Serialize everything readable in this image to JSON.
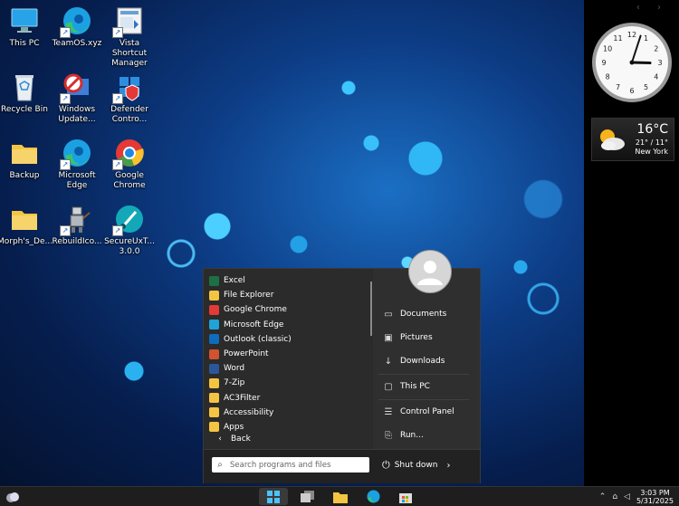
{
  "desktop": {
    "icons": [
      {
        "label": "This PC"
      },
      {
        "label": "TeamOS.xyz"
      },
      {
        "label": "Vista Shortcut Manager"
      },
      {
        "label": "Recycle Bin"
      },
      {
        "label": "Windows Update..."
      },
      {
        "label": "Defender Contro..."
      },
      {
        "label": "Backup"
      },
      {
        "label": "Microsoft Edge"
      },
      {
        "label": "Google Chrome"
      },
      {
        "label": "Morph's_De..."
      },
      {
        "label": "RebuildIco..."
      },
      {
        "label": "SecureUxT... 3.0.0"
      }
    ]
  },
  "gadgets": {
    "nav": "‹ ›",
    "clock": {
      "hour": 3,
      "minute": 3
    },
    "weather": {
      "temp": "16°C",
      "range": "21° / 11°",
      "city": "New York"
    }
  },
  "start_menu": {
    "programs": [
      {
        "label": "Excel",
        "icon": "excel-icon",
        "color": "#1d7044"
      },
      {
        "label": "File Explorer",
        "icon": "folder-icon",
        "color": "#f4c542"
      },
      {
        "label": "Google Chrome",
        "icon": "chrome-icon",
        "color": "#e53935"
      },
      {
        "label": "Microsoft Edge",
        "icon": "edge-icon",
        "color": "#1fa3d8"
      },
      {
        "label": "Outlook (classic)",
        "icon": "outlook-icon",
        "color": "#0f6cbd"
      },
      {
        "label": "PowerPoint",
        "icon": "powerpoint-icon",
        "color": "#d35230"
      },
      {
        "label": "Word",
        "icon": "word-icon",
        "color": "#2b579a"
      },
      {
        "label": "7-Zip",
        "icon": "folder-icon",
        "color": "#f4c542"
      },
      {
        "label": "AC3Filter",
        "icon": "folder-icon",
        "color": "#f4c542"
      },
      {
        "label": "Accessibility",
        "icon": "folder-icon",
        "color": "#f4c542"
      },
      {
        "label": "Apps",
        "icon": "folder-icon",
        "color": "#f4c542"
      }
    ],
    "back_label": "Back",
    "right_items": [
      {
        "label": "Documents",
        "icon": "documents-icon"
      },
      {
        "label": "Pictures",
        "icon": "pictures-icon"
      },
      {
        "label": "Downloads",
        "icon": "downloads-icon"
      },
      {
        "label": "This PC",
        "icon": "computer-icon"
      },
      {
        "label": "Control Panel",
        "icon": "control-panel-icon"
      },
      {
        "label": "Run...",
        "icon": "run-icon"
      }
    ],
    "search_placeholder": "Search programs and files",
    "shutdown_label": "Shut down"
  },
  "taskbar": {
    "time": "3:03 PM",
    "date": "5/31/2025"
  }
}
